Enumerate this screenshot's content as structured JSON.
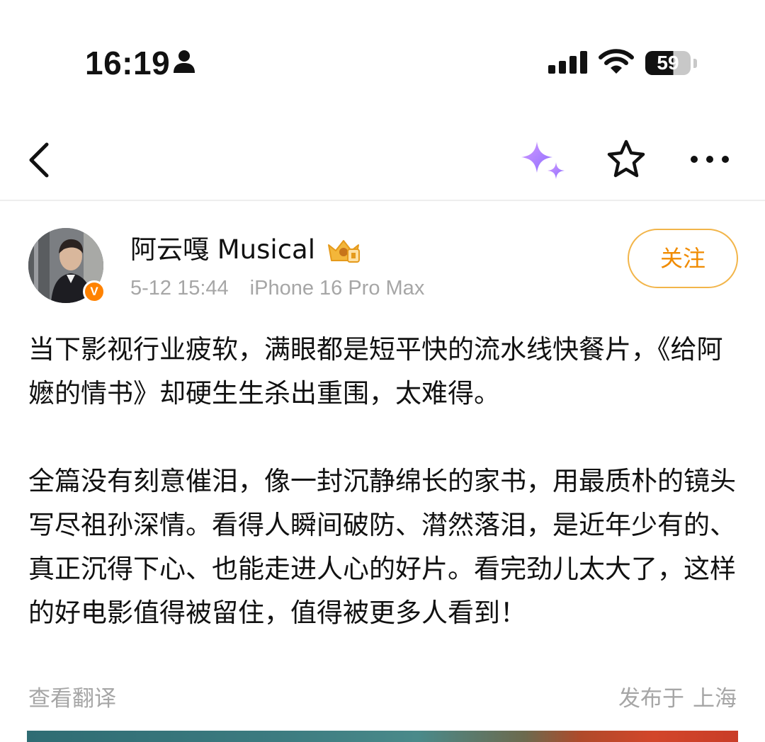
{
  "status_bar": {
    "time": "16:19",
    "battery_percent": "59",
    "icons": [
      "person-icon",
      "cellular-signal-icon",
      "wifi-icon",
      "battery-icon"
    ]
  },
  "nav": {
    "icons": [
      "back-chevron-icon",
      "ai-sparkle-icon",
      "favorite-star-icon",
      "more-ellipsis-icon"
    ],
    "colors": {
      "sparkle_start": "#c38bff",
      "sparkle_end": "#8a6dff"
    }
  },
  "author": {
    "name": "阿云嘎 Musical",
    "verified_badge": "V",
    "date": "5-12 15:44",
    "device": "iPhone 16 Pro Max",
    "follow_label": "关注",
    "colors": {
      "follow": "#f08b00",
      "badge": "#ff8200"
    }
  },
  "post": {
    "paragraphs": [
      "当下影视行业疲软，满眼都是短平快的流水线快餐片，《给阿嬷的情书》却硬生生杀出重围，太难得。",
      "全篇没有刻意催泪，像一封沉静绵长的家书，用最质朴的镜头写尽祖孙深情。看得人瞬间破防、潸然落泪，是近年少有的、真正沉得下心、也能走进人心的好片。看完劲儿太大了，这样的好电影值得被留住，值得被更多人看到！"
    ],
    "translate_label": "查看翻译",
    "location_prefix": "发布于",
    "location": "上海"
  }
}
